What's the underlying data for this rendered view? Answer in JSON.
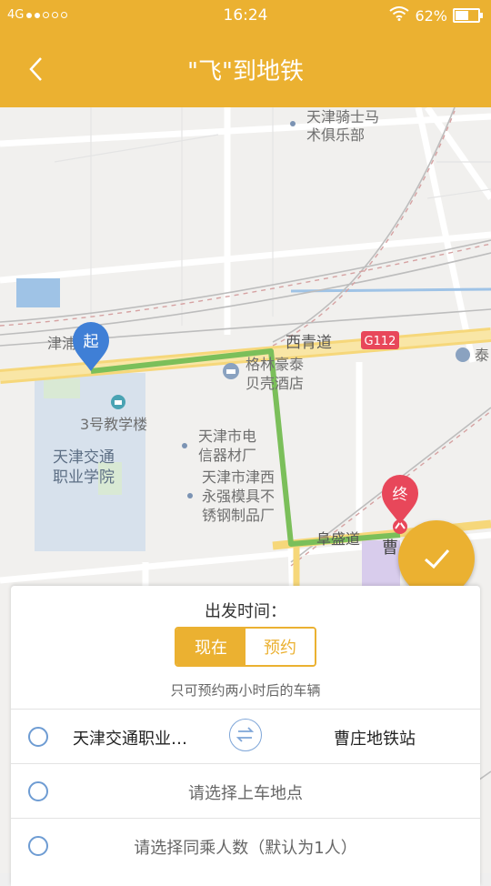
{
  "status_bar": {
    "network": "4G",
    "time": "16:24",
    "battery": "62%",
    "battery_level": 0.62
  },
  "nav": {
    "title": "\"飞\"到地铁"
  },
  "map": {
    "start_marker": "起",
    "end_marker": "终",
    "labels": {
      "poi_horse_club": [
        "天津骑士马",
        "术俱乐部"
      ],
      "road_xiqing": "西青道",
      "highway_g112": "G112",
      "poi_hotel": [
        "格林豪泰",
        "贝壳酒店"
      ],
      "poi_building3": "3号教学楼",
      "poi_college": [
        "天津交通",
        "职业学院"
      ],
      "poi_electric": [
        "天津市电",
        "信器材厂"
      ],
      "poi_steel": [
        "天津市津西",
        "永强模具不",
        "锈钢制品厂"
      ],
      "road_fusheng": "阜盛道",
      "station_partial": "曹",
      "label_jinpu": "津浦",
      "label_tai": "泰"
    }
  },
  "panel": {
    "departure_label": "出发时间：",
    "tab_now": "现在",
    "tab_reserve": "预约",
    "hint": "只可预约两小时后的车辆",
    "from": "天津交通职业…",
    "to": "曹庄地铁站",
    "pickup_placeholder": "请选择上车地点",
    "passengers_placeholder": "请选择同乘人数（默认为1人）"
  },
  "colors": {
    "accent": "#ebb131",
    "route": "#7bbf5a",
    "start_pin": "#3f7fd6",
    "end_pin": "#e8475a"
  }
}
